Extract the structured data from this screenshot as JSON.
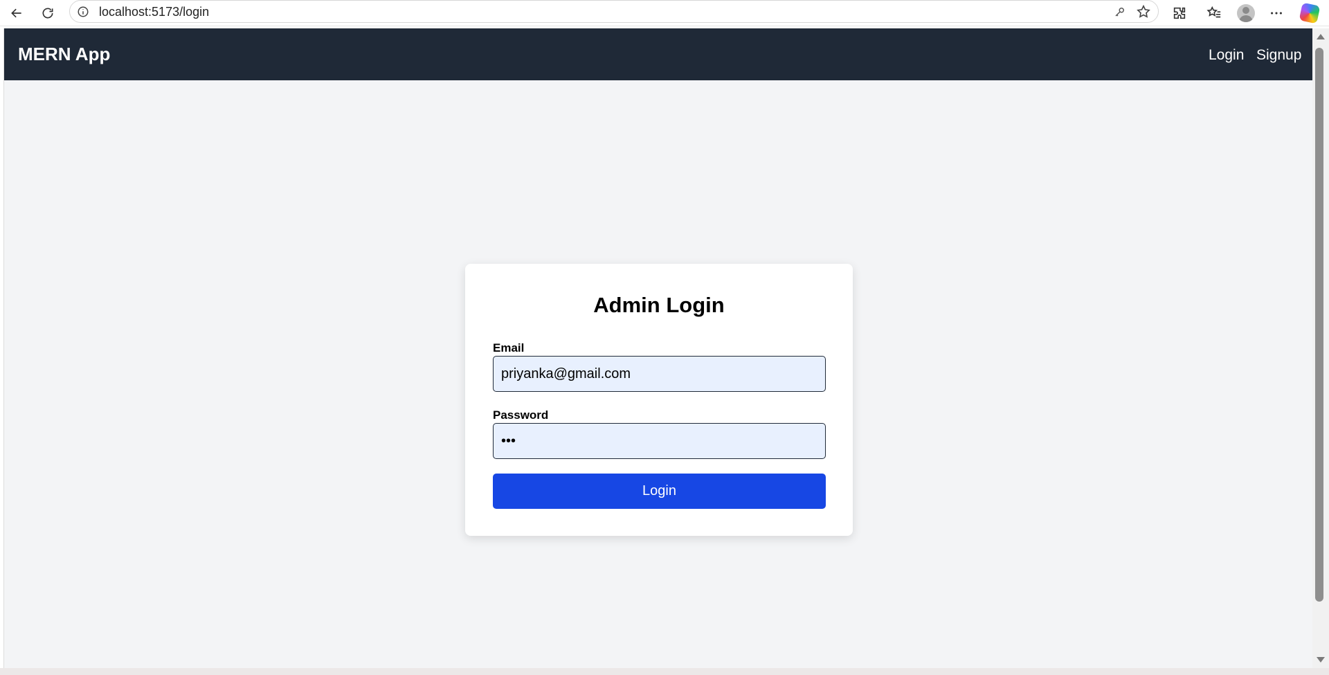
{
  "browser": {
    "url": "localhost:5173/login"
  },
  "navbar": {
    "brand": "MERN App",
    "links": [
      "Login",
      "Signup"
    ]
  },
  "form": {
    "title": "Admin Login",
    "email_label": "Email",
    "email_value": "priyanka@gmail.com",
    "password_label": "Password",
    "password_value": "abc",
    "submit_label": "Login"
  },
  "colors": {
    "navbar_bg": "#1f2937",
    "page_bg": "#f3f4f6",
    "button_bg": "#1747e4",
    "input_bg": "#e8f0fe"
  }
}
